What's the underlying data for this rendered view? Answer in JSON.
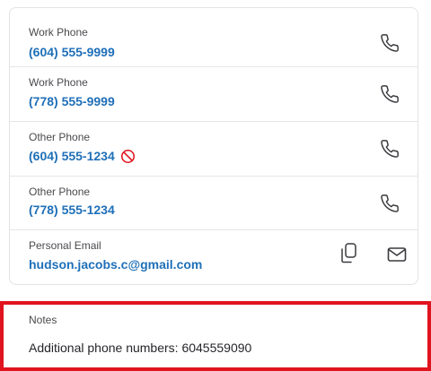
{
  "contacts": [
    {
      "label": "Work Phone",
      "value": "(604) 555-9999",
      "blocked": false,
      "action_icon": "phone-icon"
    },
    {
      "label": "Work Phone",
      "value": "(778) 555-9999",
      "blocked": false,
      "action_icon": "phone-icon"
    },
    {
      "label": "Other Phone",
      "value": "(604) 555-1234",
      "blocked": true,
      "blocked_icon": "blocked-icon",
      "action_icon": "phone-icon"
    },
    {
      "label": "Other Phone",
      "value": "(778) 555-1234",
      "blocked": false,
      "action_icon": "phone-icon"
    },
    {
      "label": "Personal Email",
      "value": "hudson.jacobs.c@gmail.com",
      "blocked": false,
      "action_icons": [
        "copy-icon",
        "mail-icon"
      ]
    }
  ],
  "notes": {
    "label": "Notes",
    "text": "Additional phone numbers: 6045559090"
  },
  "colors": {
    "link": "#1f6fb8",
    "label": "#4a4a4f",
    "blocked": "#e0141e",
    "highlight_border": "#e0141e",
    "card_border": "#e3e3e6"
  }
}
